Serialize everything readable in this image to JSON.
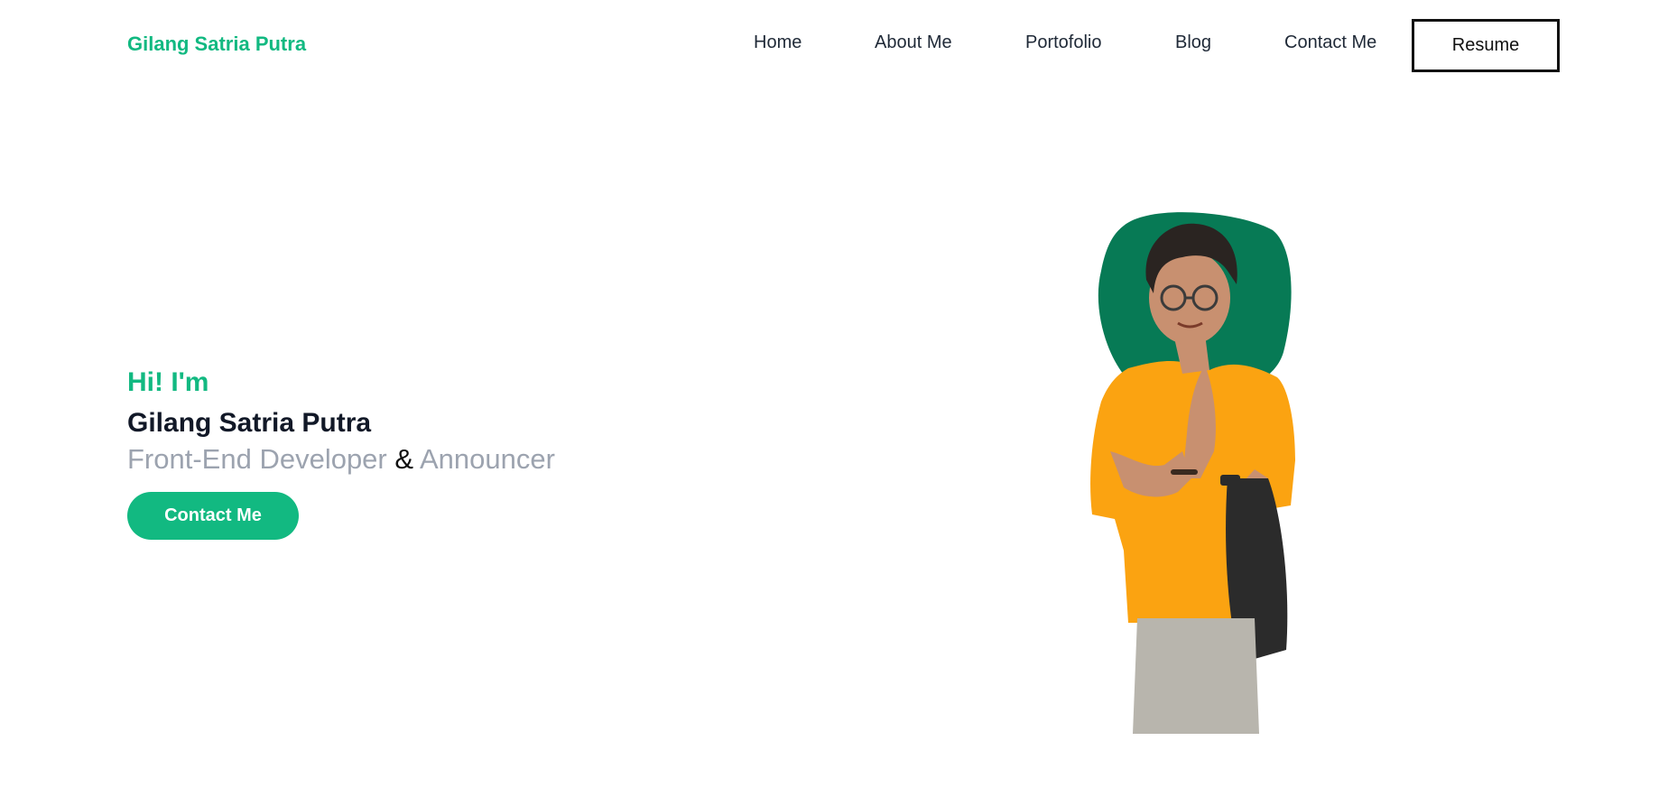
{
  "nav": {
    "brand": "Gilang Satria Putra",
    "links": [
      {
        "label": "Home"
      },
      {
        "label": "About Me"
      },
      {
        "label": "Portofolio"
      },
      {
        "label": "Blog"
      },
      {
        "label": "Contact Me"
      }
    ],
    "resume_label": "Resume"
  },
  "hero": {
    "greeting": "Hi! I'm",
    "name": "Gilang Satria Putra",
    "role_primary": "Front-End Developer",
    "role_separator": "&",
    "role_secondary": "Announcer",
    "cta_label": "Contact Me"
  },
  "colors": {
    "accent": "#12b981",
    "blob": "#077a55",
    "shirt": "#fba311",
    "pants": "#b8b5ad",
    "bag": "#2b2b2b",
    "skin": "#c89070",
    "hair": "#2a2421"
  },
  "icons": {
    "portrait": "person-portrait-image"
  }
}
